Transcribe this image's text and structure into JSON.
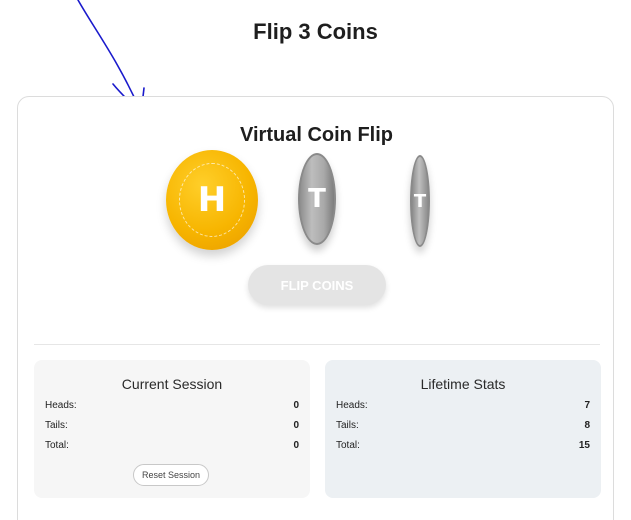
{
  "page": {
    "title": "Flip 3 Coins"
  },
  "card": {
    "title": "Virtual Coin Flip",
    "coins": [
      {
        "face": "H",
        "state": "heads",
        "color": "#f7b500"
      },
      {
        "face": "T",
        "state": "tails-flipping",
        "color": "#a9a9a9"
      },
      {
        "face": "T",
        "state": "tails-flipping",
        "color": "#a9a9a9"
      }
    ],
    "flip_button": {
      "label": "FLIP COINS",
      "disabled": true
    }
  },
  "current_session": {
    "title": "Current Session",
    "rows": [
      {
        "label": "Heads:",
        "value": "0"
      },
      {
        "label": "Tails:",
        "value": "0"
      },
      {
        "label": "Total:",
        "value": "0"
      }
    ],
    "reset_label": "Reset Session"
  },
  "lifetime_stats": {
    "title": "Lifetime Stats",
    "rows": [
      {
        "label": "Heads:",
        "value": "7"
      },
      {
        "label": "Tails:",
        "value": "8"
      },
      {
        "label": "Total:",
        "value": "15"
      }
    ]
  },
  "annotation": {
    "icon": "hand-drawn-arrow-icon",
    "color": "#1a1acc"
  }
}
